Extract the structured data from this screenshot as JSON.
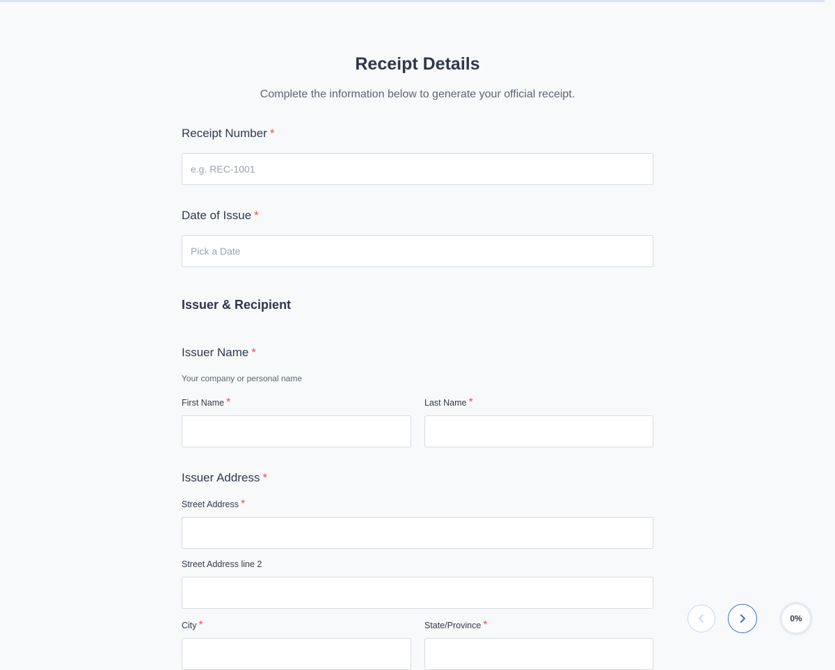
{
  "form": {
    "title": "Receipt Details",
    "subtitle": "Complete the information below to generate your official receipt.",
    "receipt_number": {
      "label": "Receipt Number",
      "required_mark": "*",
      "placeholder": "e.g. REC-1001",
      "value": ""
    },
    "date_of_issue": {
      "label": "Date of Issue",
      "required_mark": "*",
      "placeholder": "Pick a Date",
      "value": ""
    },
    "section_issuer_recipient": "Issuer & Recipient",
    "issuer_name": {
      "label": "Issuer Name",
      "required_mark": "*",
      "hint": "Your company or personal name",
      "first_name_label": "First Name",
      "last_name_label": "Last Name",
      "first_name_value": "",
      "last_name_value": ""
    },
    "issuer_address": {
      "label": "Issuer Address",
      "required_mark": "*",
      "street_label": "Street Address",
      "street2_label": "Street Address line 2",
      "city_label": "City",
      "state_label": "State/Province",
      "street_value": "",
      "street2_value": "",
      "city_value": "",
      "state_value": ""
    }
  },
  "navigation": {
    "prev_icon": "chevron-left-icon",
    "next_icon": "chevron-right-icon",
    "progress_text": "0%",
    "progress": 0
  },
  "colors": {
    "required": "#e5534b",
    "accent": "#3b6fd4",
    "background": "#f8f9fb"
  }
}
